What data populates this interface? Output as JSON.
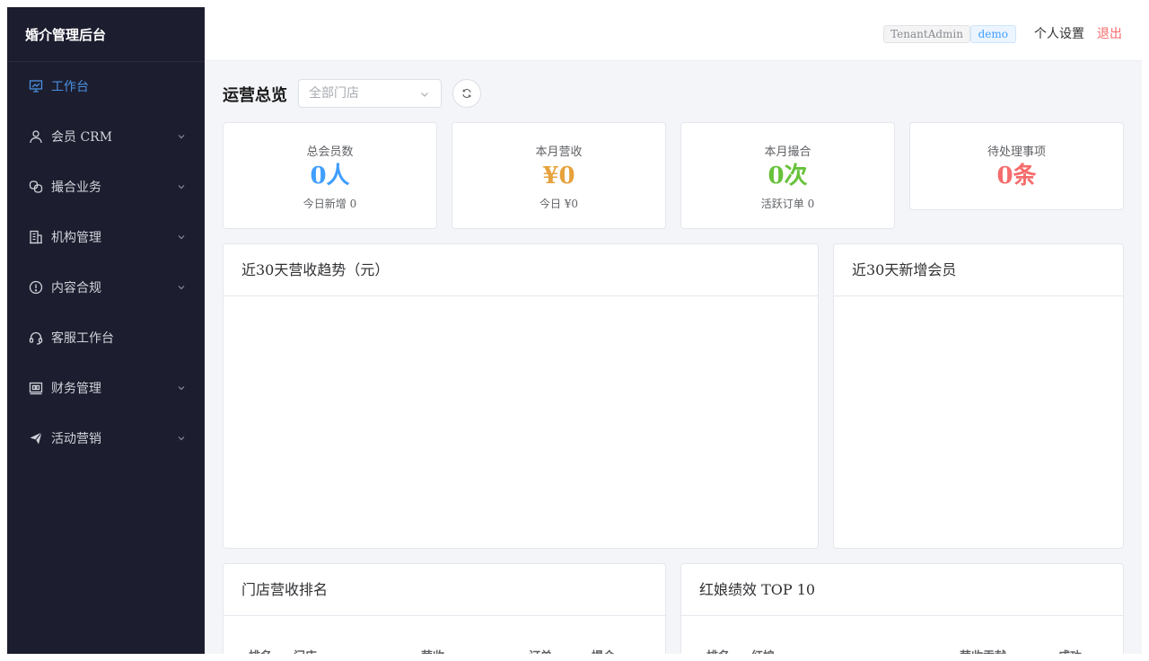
{
  "app": {
    "title": "婚介管理后台"
  },
  "sidebar": {
    "items": [
      {
        "label": "工作台",
        "icon": "dashboard-icon",
        "active": true
      },
      {
        "label": "会员 CRM",
        "icon": "user-icon",
        "expandable": true
      },
      {
        "label": "撮合业务",
        "icon": "match-icon",
        "expandable": true
      },
      {
        "label": "机构管理",
        "icon": "building-icon",
        "expandable": true
      },
      {
        "label": "内容合规",
        "icon": "warning-circle-icon",
        "expandable": true
      },
      {
        "label": "客服工作台",
        "icon": "headset-icon",
        "expandable": false
      },
      {
        "label": "财务管理",
        "icon": "wallet-icon",
        "expandable": true
      },
      {
        "label": "活动营销",
        "icon": "send-icon",
        "expandable": true
      }
    ]
  },
  "header": {
    "tenant_tag": "TenantAdmin",
    "user_tag": "demo",
    "settings_label": "个人设置",
    "logout_label": "退出"
  },
  "overview": {
    "title": "运营总览",
    "store_placeholder": "全部门店"
  },
  "stats": [
    {
      "label": "总会员数",
      "value": "0人",
      "sub": "今日新增 0",
      "color": "#409eff"
    },
    {
      "label": "本月营收",
      "value": "¥0",
      "sub": "今日 ¥0",
      "color": "#e6a23c"
    },
    {
      "label": "本月撮合",
      "value": "0次",
      "sub": "活跃订单 0",
      "color": "#67c23a"
    },
    {
      "label": "待处理事项",
      "value": "0条",
      "sub": "",
      "color": "#f56c6c"
    }
  ],
  "panels": {
    "revenue_trend": {
      "title": "近30天营收趋势（元）"
    },
    "new_members": {
      "title": "近30天新增会员"
    },
    "store_ranking": {
      "title": "门店营收排名",
      "columns": [
        "排名",
        "门店",
        "营收",
        "订单",
        "撮合"
      ]
    },
    "matchmaker_top": {
      "title": "红娘绩效 TOP 10",
      "columns": [
        "排名",
        "红娘",
        "营收贡献",
        "成功"
      ]
    }
  },
  "colors": {
    "sidebar_bg": "#1c1d2e",
    "accent": "#4a90e2",
    "danger": "#f56c6c"
  }
}
